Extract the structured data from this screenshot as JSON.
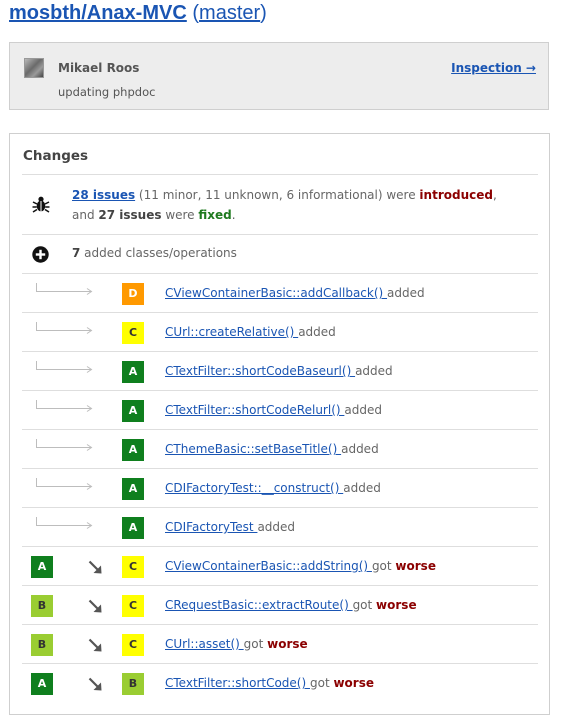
{
  "header": {
    "repo": "mosbth/Anax-MVC",
    "paren_open": "(",
    "branch": "master",
    "paren_close": ")"
  },
  "commit": {
    "author": "Mikael Roos",
    "message": "updating phpdoc",
    "inspection_label": "Inspection →"
  },
  "changes": {
    "title": "Changes",
    "issues": {
      "introduced_link": "28 issues",
      "introduced_detail": " (11 minor, 11 unknown, 6 informational) were ",
      "introduced_word": "introduced",
      "comma": ",",
      "and_text": "and ",
      "fixed_count": "27",
      "fixed_issues_word": " issues",
      "were_text": " were ",
      "fixed_word": "fixed",
      "period": "."
    },
    "added": {
      "count": "7",
      "label": " added classes/operations"
    },
    "items": [
      {
        "old_grade": "",
        "new_grade": "D",
        "name": "CViewContainerBasic::addCallback() ",
        "status": "added",
        "status_type": "added"
      },
      {
        "old_grade": "",
        "new_grade": "C",
        "name": "CUrl::createRelative() ",
        "status": "added",
        "status_type": "added"
      },
      {
        "old_grade": "",
        "new_grade": "A",
        "name": "CTextFilter::shortCodeBaseurl() ",
        "status": "added",
        "status_type": "added"
      },
      {
        "old_grade": "",
        "new_grade": "A",
        "name": "CTextFilter::shortCodeRelurl() ",
        "status": "added",
        "status_type": "added"
      },
      {
        "old_grade": "",
        "new_grade": "A",
        "name": "CThemeBasic::setBaseTitle() ",
        "status": "added",
        "status_type": "added"
      },
      {
        "old_grade": "",
        "new_grade": "A",
        "name": "CDIFactoryTest::__construct() ",
        "status": "added",
        "status_type": "added"
      },
      {
        "old_grade": "",
        "new_grade": "A",
        "name": "CDIFactoryTest ",
        "status": "added",
        "status_type": "added"
      },
      {
        "old_grade": "A",
        "new_grade": "C",
        "name": "CViewContainerBasic::addString() ",
        "got": "got ",
        "status": "worse",
        "status_type": "worse"
      },
      {
        "old_grade": "B",
        "new_grade": "C",
        "name": "CRequestBasic::extractRoute() ",
        "got": "got ",
        "status": "worse",
        "status_type": "worse"
      },
      {
        "old_grade": "B",
        "new_grade": "C",
        "name": "CUrl::asset() ",
        "got": "got ",
        "status": "worse",
        "status_type": "worse"
      },
      {
        "old_grade": "A",
        "new_grade": "B",
        "name": "CTextFilter::shortCode() ",
        "got": "got ",
        "status": "worse",
        "status_type": "worse"
      }
    ]
  },
  "icons": {
    "bug": "bug-icon",
    "plus": "plus-circle-icon",
    "connector": "tree-connector-arrow-icon",
    "degrade": "arrow-down-right-icon"
  },
  "colors": {
    "link": "#1a55b3",
    "introduced": "#8b0000",
    "fixed": "#1f7a1f",
    "grade_A": "#0f7f1e",
    "grade_B": "#9acd32",
    "grade_C": "#ffff00",
    "grade_D": "#ff9900"
  }
}
